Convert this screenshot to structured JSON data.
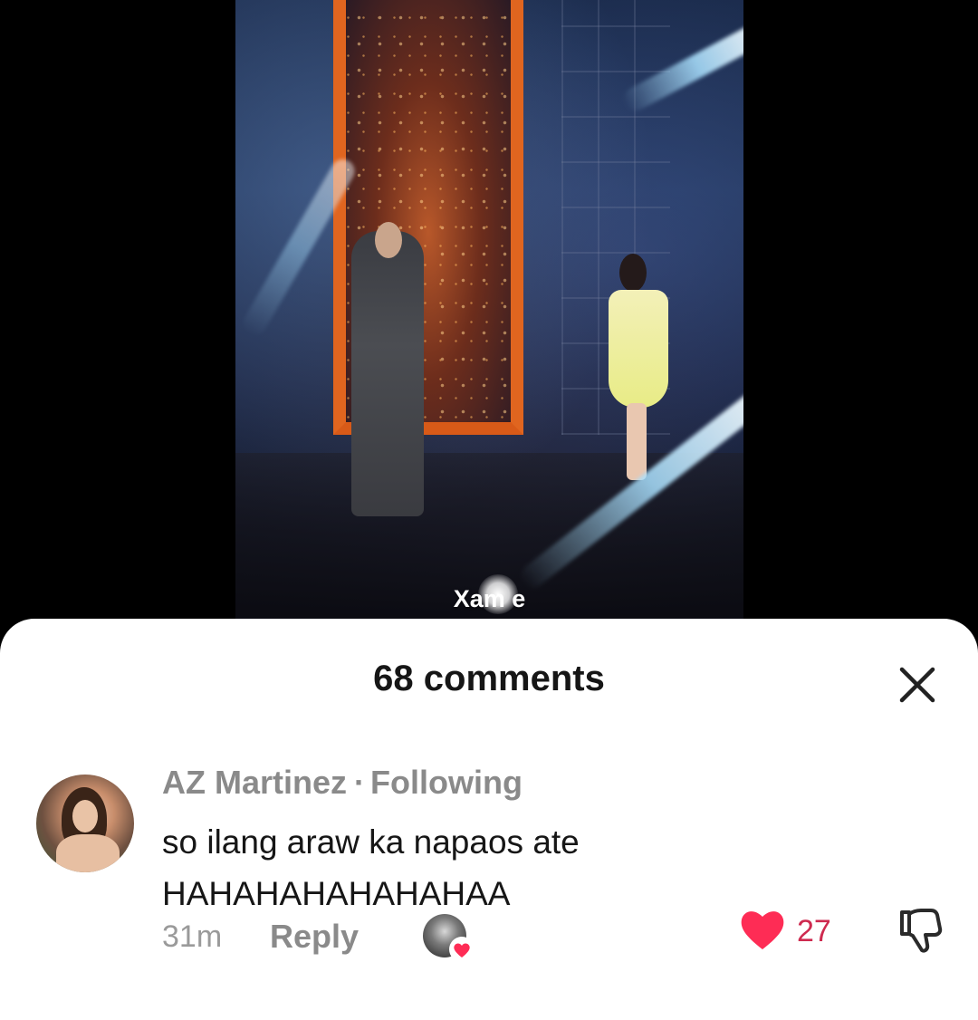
{
  "video": {
    "watermark": "Xam  e"
  },
  "comments_sheet": {
    "title": "68 comments",
    "close_icon": "close-icon"
  },
  "comment": {
    "author": "AZ Martinez",
    "separator": "·",
    "relation": "Following",
    "text": "so ilang araw ka napaos ate\nHAHAHAHAHAHAHAA",
    "time": "31m",
    "reply_label": "Reply",
    "like_count": "27",
    "liked": true,
    "icons": {
      "like": "heart-icon",
      "dislike": "thumbs-down-icon",
      "creator_liked": "heart-badge-icon"
    },
    "colors": {
      "like": "#fe2c55",
      "like_count": "#ce2a4f",
      "meta": "#8a8a8a"
    }
  }
}
